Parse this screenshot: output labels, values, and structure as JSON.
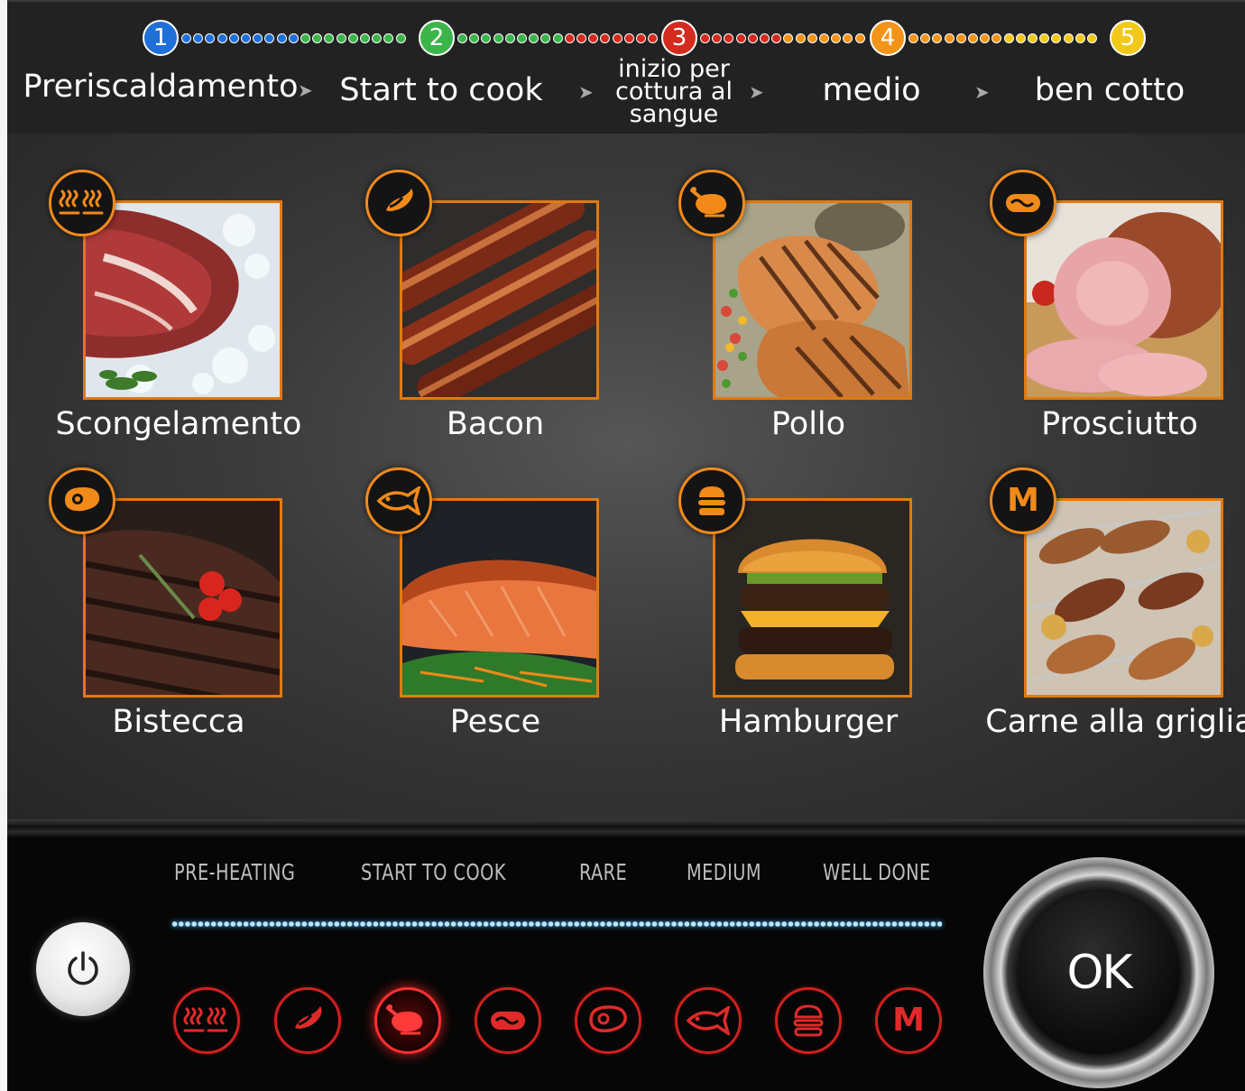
{
  "colors": {
    "step_colors": [
      "#1f6fd8",
      "#3bb54a",
      "#d42b1e",
      "#f39419",
      "#f2c81a"
    ],
    "accent": "#f28a1a",
    "touch_key": "#d02020",
    "indicator": "#9fdcff"
  },
  "steps": [
    {
      "number": "1",
      "label": "Preriscaldamento"
    },
    {
      "number": "2",
      "label": "Start to cook"
    },
    {
      "number": "3",
      "label": "inizio per\ncottura al\nsangue"
    },
    {
      "number": "4",
      "label": "medio"
    },
    {
      "number": "5",
      "label": "ben cotto"
    }
  ],
  "programs": [
    {
      "label": "Scongelamento",
      "icon": "defrost-icon"
    },
    {
      "label": "Bacon",
      "icon": "bacon-icon"
    },
    {
      "label": "Pollo",
      "icon": "chicken-icon"
    },
    {
      "label": "Prosciutto",
      "icon": "sausage-icon"
    },
    {
      "label": "Bistecca",
      "icon": "steak-icon"
    },
    {
      "label": "Pesce",
      "icon": "fish-icon"
    },
    {
      "label": "Hamburger",
      "icon": "burger-icon"
    },
    {
      "label": "Carne alla griglia",
      "icon": "manual-icon"
    }
  ],
  "control_panel": {
    "status_labels": [
      "PRE-HEATING",
      "START  TO  COOK",
      "RARE",
      "MEDIUM",
      "WELL  DONE"
    ],
    "power_icon": "power-icon",
    "keys": [
      "defrost-icon",
      "bacon-icon",
      "chicken-icon",
      "sausage-icon",
      "steak-icon",
      "fish-icon",
      "burger-icon",
      "manual-icon"
    ],
    "active_key": "chicken-icon",
    "ok_label": "OK",
    "manual_letter": "M"
  }
}
